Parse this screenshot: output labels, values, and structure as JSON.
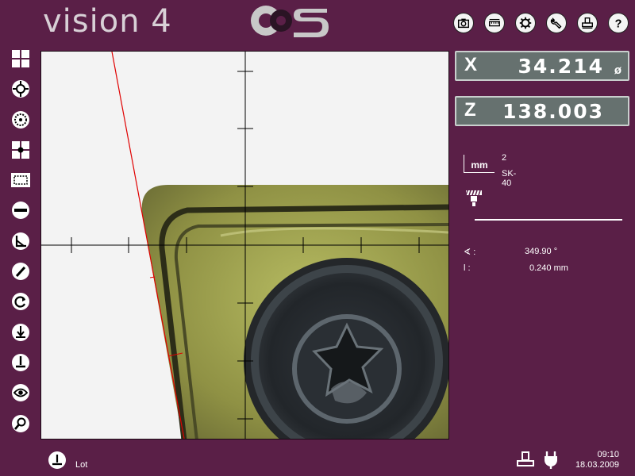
{
  "app": {
    "title": "vision 4",
    "logo_text": "OCS"
  },
  "toolbar": {
    "buttons": [
      {
        "name": "camera-icon"
      },
      {
        "name": "ruler-icon"
      },
      {
        "name": "gear-icon"
      },
      {
        "name": "wrench-icon"
      },
      {
        "name": "printer-icon"
      },
      {
        "name": "help-icon"
      }
    ]
  },
  "sidebar": {
    "buttons": [
      {
        "name": "grid-view-icon"
      },
      {
        "name": "crosshair-target-icon"
      },
      {
        "name": "circle-point-icon"
      },
      {
        "name": "grid-center-icon"
      },
      {
        "name": "rectangle-select-icon"
      },
      {
        "name": "line-measure-icon"
      },
      {
        "name": "angle-measure-icon"
      },
      {
        "name": "radius-measure-icon"
      },
      {
        "name": "refresh-icon"
      },
      {
        "name": "edge-tool-icon"
      },
      {
        "name": "tool-base-icon"
      },
      {
        "name": "eye-icon"
      },
      {
        "name": "zoom-icon"
      }
    ]
  },
  "readouts": {
    "x": {
      "axis": "X",
      "value": "34.214",
      "unit_symbol": "ø"
    },
    "z": {
      "axis": "Z",
      "value": "138.003"
    }
  },
  "tool": {
    "unit": "mm",
    "number": "2",
    "name": "SK-40"
  },
  "measurements": {
    "angle": {
      "label": "∢ :",
      "value": "349.90 °"
    },
    "length": {
      "label": "l :",
      "value": "0.240 mm"
    }
  },
  "footer": {
    "lot_label": "Lot",
    "time": "09:10",
    "date": "18.03.2009"
  },
  "colors": {
    "background": "#5a1f47",
    "readout_bg": "#66716f",
    "edge_line": "#e00000"
  }
}
